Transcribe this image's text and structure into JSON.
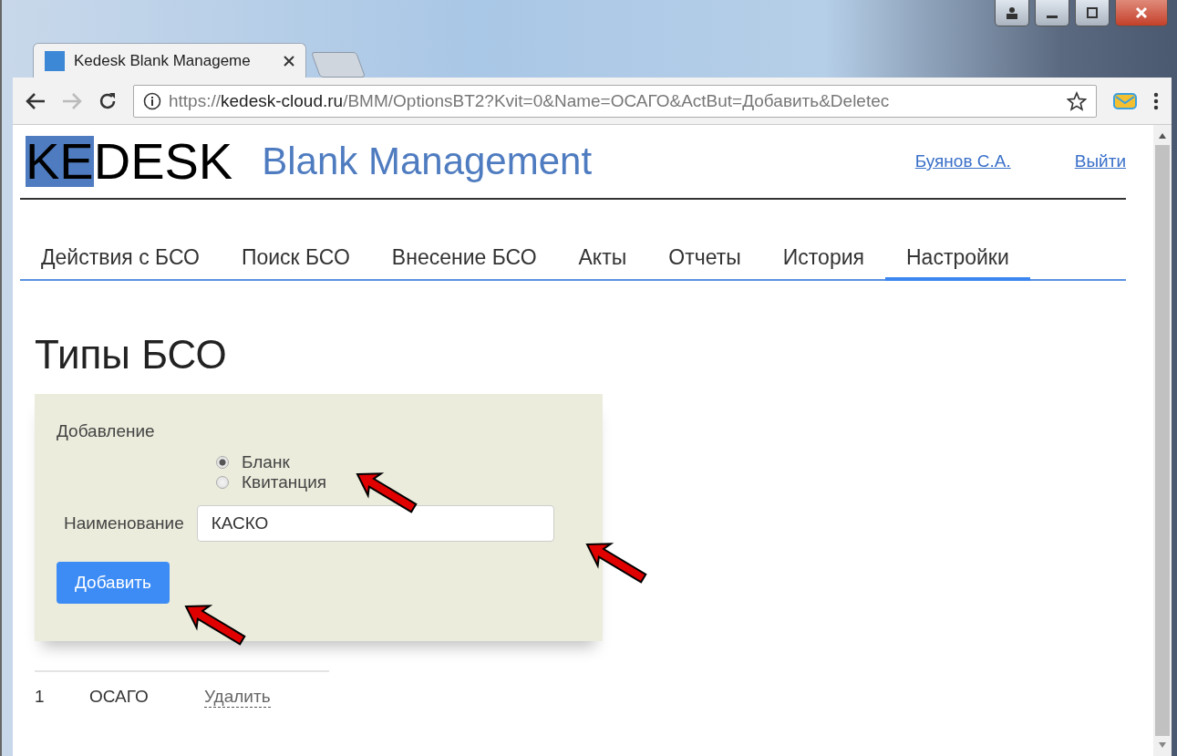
{
  "browser": {
    "tab_title": "Kedesk Blank Manageme",
    "url": {
      "scheme": "https://",
      "host": "kedesk-cloud.ru",
      "path": "/BMM/OptionsBT2?Kvit=0&Name=ОСАГО&ActBut=Добавить&Deletec"
    }
  },
  "header": {
    "logo": {
      "highlighted": "KE",
      "rest": "DESK"
    },
    "app_title": "Blank Management",
    "user_link": "Буянов С.А.",
    "logout_link": "Выйти"
  },
  "nav": [
    {
      "label": "Действия с БСО",
      "selected": false
    },
    {
      "label": "Поиск БСО",
      "selected": false
    },
    {
      "label": "Внесение БСО",
      "selected": false
    },
    {
      "label": "Акты",
      "selected": false
    },
    {
      "label": "Отчеты",
      "selected": false
    },
    {
      "label": "История",
      "selected": false
    },
    {
      "label": "Настройки",
      "selected": true
    }
  ],
  "page_title": "Типы БСО",
  "form": {
    "section_label": "Добавление",
    "types": [
      {
        "label": "Бланк",
        "selected": true
      },
      {
        "label": "Квитанция",
        "selected": false
      }
    ],
    "name_label": "Наименование",
    "name_value": "КАСКО",
    "submit": "Добавить"
  },
  "table": {
    "rows": [
      {
        "number": "1",
        "name": "ОСАГО",
        "action": "Удалить"
      }
    ]
  }
}
